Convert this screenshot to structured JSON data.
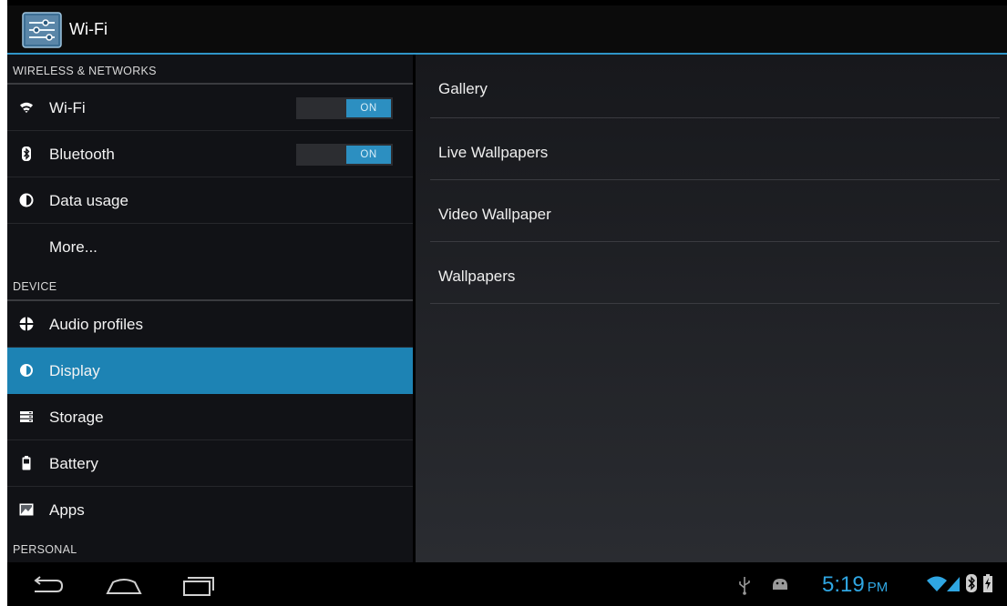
{
  "action_bar": {
    "title": "Wi-Fi",
    "icon": "settings-sliders-icon"
  },
  "left_pane": {
    "sections": [
      {
        "header": "WIRELESS & NETWORKS",
        "items": [
          {
            "label": "Wi-Fi",
            "icon": "wifi-icon",
            "toggle": "ON"
          },
          {
            "label": "Bluetooth",
            "icon": "bluetooth-icon",
            "toggle": "ON"
          },
          {
            "label": "Data usage",
            "icon": "data-usage-icon"
          },
          {
            "label": "More..."
          }
        ]
      },
      {
        "header": "DEVICE",
        "items": [
          {
            "label": "Audio profiles",
            "icon": "audio-profiles-icon"
          },
          {
            "label": "Display",
            "icon": "display-icon",
            "selected": true
          },
          {
            "label": "Storage",
            "icon": "storage-icon"
          },
          {
            "label": "Battery",
            "icon": "battery-icon"
          },
          {
            "label": "Apps",
            "icon": "apps-icon"
          }
        ]
      },
      {
        "header": "PERSONAL",
        "items": []
      }
    ]
  },
  "right_pane": {
    "items": [
      {
        "label": "Gallery"
      },
      {
        "label": "Live Wallpapers"
      },
      {
        "label": "Video Wallpaper"
      },
      {
        "label": "Wallpapers"
      }
    ]
  },
  "nav_bar": {
    "buttons": [
      "back-icon",
      "home-icon",
      "recent-apps-icon"
    ]
  },
  "status_bar": {
    "time": "5:19",
    "ampm": "PM",
    "icons": [
      "usb-icon",
      "android-debug-icon",
      "wifi-signal-icon",
      "cell-signal-icon",
      "bluetooth-icon",
      "battery-charging-icon"
    ]
  },
  "colors": {
    "accent": "#2f95c8",
    "selected_row": "#1d83b4",
    "clock": "#2fa6e2"
  }
}
